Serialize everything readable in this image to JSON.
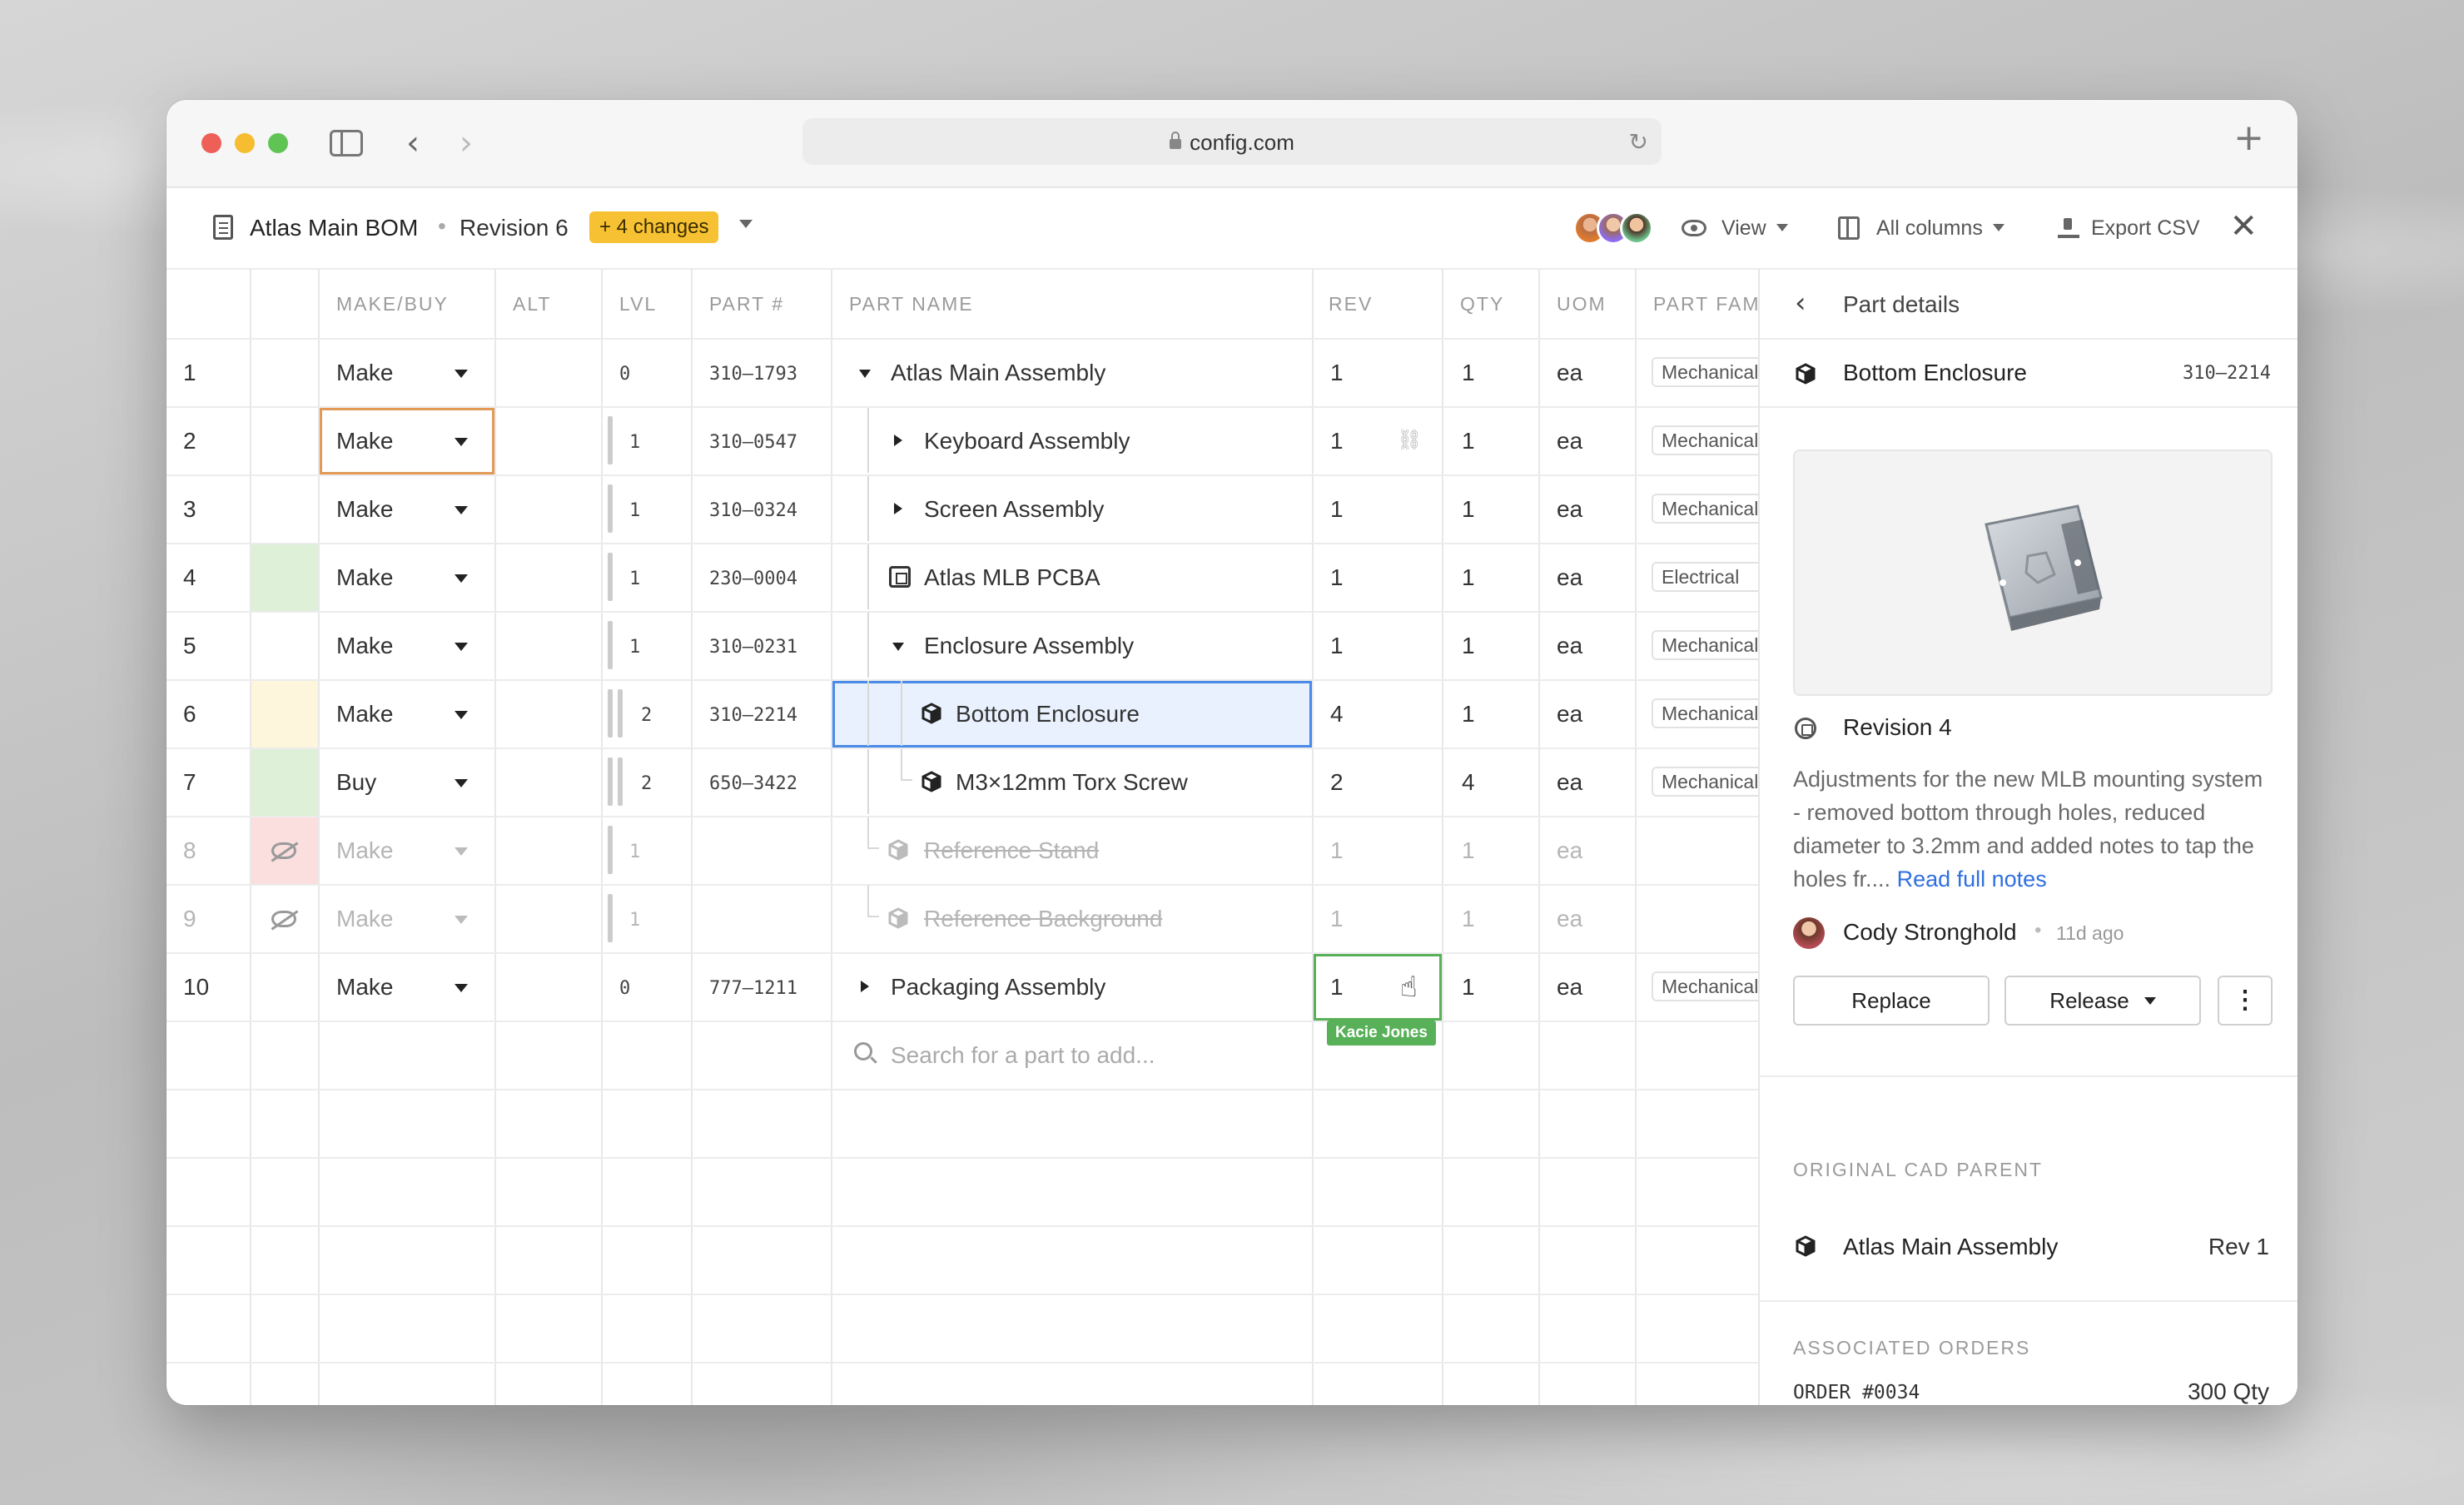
{
  "browser": {
    "url": "config.com"
  },
  "header": {
    "bom_title": "Atlas Main BOM",
    "separator": "•",
    "revision": "Revision 6",
    "changes_badge": "+ 4 changes",
    "view_label": "View",
    "columns_label": "All columns",
    "export_label": "Export CSV"
  },
  "grid": {
    "columns": [
      "MAKE/BUY",
      "ALT",
      "LVL",
      "PART #",
      "PART NAME",
      "REV",
      "QTY",
      "UOM",
      "PART FAM"
    ],
    "rows": [
      {
        "n": "1",
        "make": "Make",
        "lvl": "0",
        "part": "310–1793",
        "name": "Atlas Main Assembly",
        "rev": "1",
        "qty": "1",
        "uom": "ea",
        "fam": "Mechanical"
      },
      {
        "n": "2",
        "make": "Make",
        "lvl": "1",
        "part": "310–0547",
        "name": "Keyboard Assembly",
        "rev": "1",
        "qty": "1",
        "uom": "ea",
        "fam": "Mechanical"
      },
      {
        "n": "3",
        "make": "Make",
        "lvl": "1",
        "part": "310–0324",
        "name": "Screen Assembly",
        "rev": "1",
        "qty": "1",
        "uom": "ea",
        "fam": "Mechanical"
      },
      {
        "n": "4",
        "make": "Make",
        "lvl": "1",
        "part": "230–0004",
        "name": "Atlas MLB PCBA",
        "rev": "1",
        "qty": "1",
        "uom": "ea",
        "fam": "Electrical"
      },
      {
        "n": "5",
        "make": "Make",
        "lvl": "1",
        "part": "310–0231",
        "name": "Enclosure Assembly",
        "rev": "1",
        "qty": "1",
        "uom": "ea",
        "fam": "Mechanical"
      },
      {
        "n": "6",
        "make": "Make",
        "lvl": "2",
        "part": "310–2214",
        "name": "Bottom Enclosure",
        "rev": "4",
        "qty": "1",
        "uom": "ea",
        "fam": "Mechanical"
      },
      {
        "n": "7",
        "make": "Buy",
        "lvl": "2",
        "part": "650–3422",
        "name": "M3×12mm Torx Screw",
        "rev": "2",
        "qty": "4",
        "uom": "ea",
        "fam": "Mechanical"
      },
      {
        "n": "8",
        "make": "Make",
        "lvl": "1",
        "part": "",
        "name": "Reference Stand",
        "rev": "1",
        "qty": "1",
        "uom": "ea",
        "fam": ""
      },
      {
        "n": "9",
        "make": "Make",
        "lvl": "1",
        "part": "",
        "name": "Reference Background",
        "rev": "1",
        "qty": "1",
        "uom": "ea",
        "fam": ""
      },
      {
        "n": "10",
        "make": "Make",
        "lvl": "0",
        "part": "777–1211",
        "name": "Packaging Assembly",
        "rev": "1",
        "qty": "1",
        "uom": "ea",
        "fam": "Mechanical"
      }
    ],
    "search_placeholder": "Search for a part to add...",
    "collaborator_tag": "Kacie Jones",
    "colors": {
      "green": "#dff0d8",
      "yellow": "#fdf5dc",
      "red": "#fbdede",
      "selected": "#e8f1fd",
      "selected_border": "#4a8ae8",
      "edit_border": "#e39a57",
      "collab_border": "#58b058"
    }
  },
  "panel": {
    "title": "Part details",
    "part_name": "Bottom Enclosure",
    "part_number": "310–2214",
    "revision": "Revision 4",
    "notes": "Adjustments for the new MLB mounting system - removed bottom through holes, reduced diameter to 3.2mm and added notes to tap the holes fr....",
    "notes_link": "Read full notes",
    "author": "Cody Stronghold",
    "author_sep": "•",
    "time_ago": "11d ago",
    "replace_label": "Replace",
    "release_label": "Release",
    "more_label": "⋮",
    "cad_parent_heading": "ORIGINAL CAD PARENT",
    "cad_parent_name": "Atlas Main Assembly",
    "cad_parent_rev": "Rev 1",
    "orders_heading": "ASSOCIATED ORDERS",
    "order_id": "ORDER #0034",
    "order_qty": "300 Qty"
  }
}
